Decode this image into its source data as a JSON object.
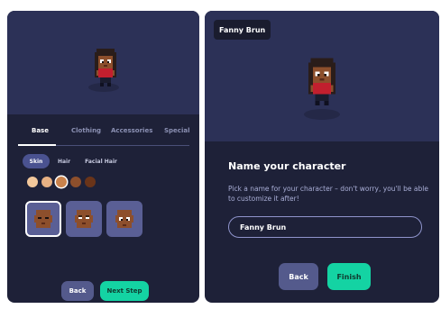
{
  "character_name": "Fanny Brun",
  "tabs": [
    "Base",
    "Clothing",
    "Accessories",
    "Special"
  ],
  "subtabs": [
    "Skin",
    "Hair",
    "Facial Hair"
  ],
  "skin_swatches": [
    "#f3c89c",
    "#e7b184",
    "#c9824c",
    "#8d4f2c",
    "#6a3419"
  ],
  "selected_swatch_index": 2,
  "selected_face_index": 0,
  "buttons": {
    "back": "Back",
    "next_step": "Next Step",
    "finish": "Finish"
  },
  "name_panel": {
    "heading": "Name your character",
    "description": "Pick a name for your character – don't worry, you'll be able to customize it after!",
    "input_value": "Fanny Brun"
  },
  "colors": {
    "accent": "#14d3a3",
    "panel": "#1e2138",
    "preview": "#2c3157",
    "secondary_button": "#545a8c"
  }
}
